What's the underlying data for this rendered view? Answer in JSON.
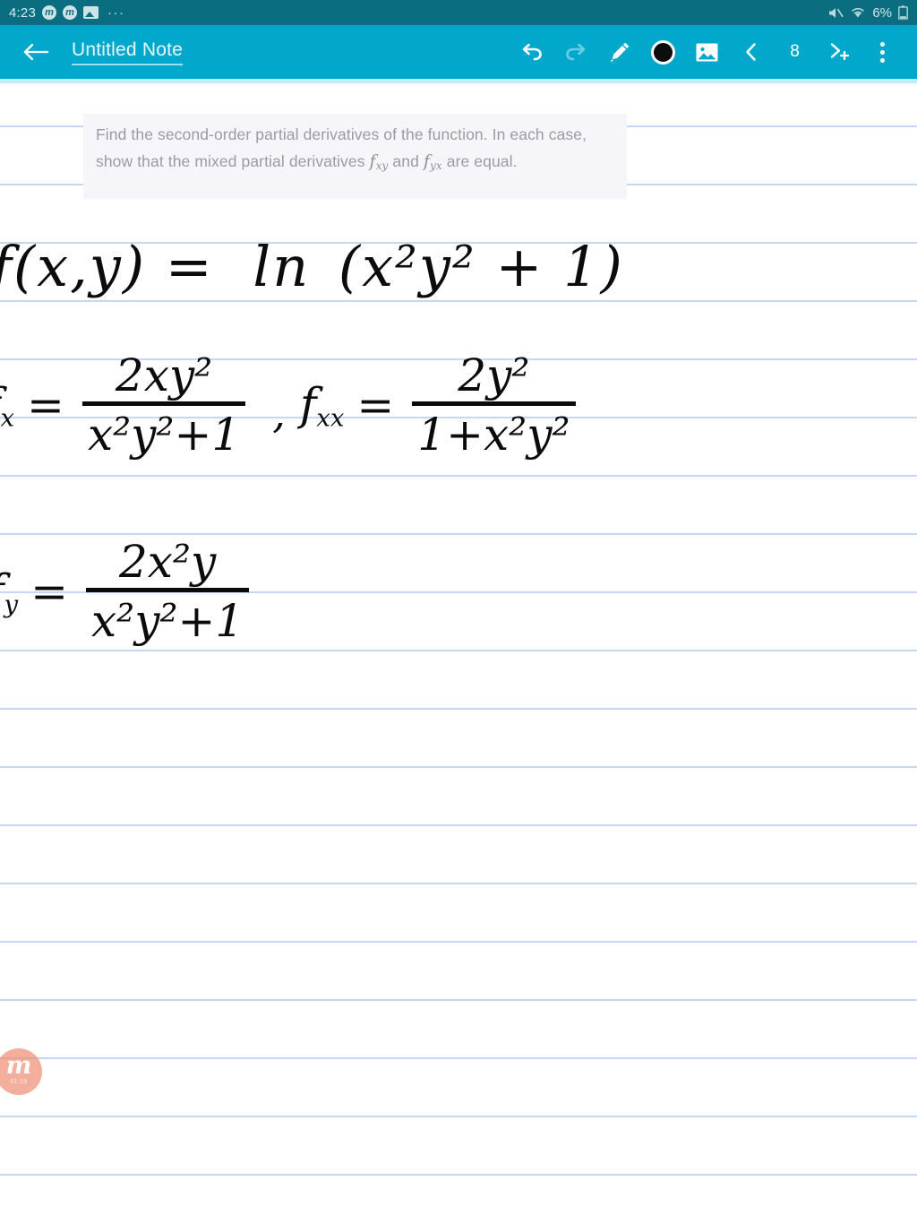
{
  "status_bar": {
    "clock": "4:23",
    "app_badge_1": "m",
    "app_badge_2": "m",
    "image_icon": "image-icon",
    "overflow": "···",
    "mute_icon": "volume-mute-icon",
    "wifi_icon": "wifi-icon",
    "battery_percent": "6%",
    "battery_icon": "battery-icon"
  },
  "app_bar": {
    "back_icon": "back-arrow-icon",
    "note_title": "Untitled Note",
    "tools": [
      {
        "name": "undo-button",
        "icon": "undo-icon",
        "enabled": true
      },
      {
        "name": "redo-button",
        "icon": "redo-icon",
        "enabled": false
      },
      {
        "name": "pen-button",
        "icon": "pencil-icon",
        "enabled": true
      },
      {
        "name": "color-button",
        "icon": "color-swatch",
        "enabled": true
      },
      {
        "name": "insert-image-button",
        "icon": "image-icon",
        "enabled": true
      },
      {
        "name": "prev-page-button",
        "icon": "chevron-left-icon",
        "enabled": true
      }
    ],
    "page_number": "8",
    "add_page_icon": "chevron-right-plus-icon",
    "menu_icon": "kebab-menu-icon",
    "accent_color": "#02a8cb",
    "status_color": "#0a6d80"
  },
  "note": {
    "question_block": {
      "line1": "Find the second-order partial derivatives of the function. In each",
      "line2_a": "case, show that the mixed partial derivatives",
      "math_fxy": "f",
      "math_fxy_sub": "xy",
      "line2_b": "and",
      "math_fyx": "f",
      "math_fyx_sub": "yx",
      "line2_c": "are",
      "line3": "equal.",
      "background": "#f6f6fa",
      "text_color": "#9a9ca1"
    },
    "handwriting": {
      "line1": {
        "lhs": "f(x,y) =",
        "fn": "ln",
        "arg": "(x²y² + 1)",
        "plain": "f(x,y) = ln(x²y² + 1)"
      },
      "line2": {
        "label_a": "f",
        "label_a_sub": "x",
        "eq": "=",
        "num_a": "2xy²",
        "den_a": "x²y²+1",
        "separator": ",",
        "label_b": "f",
        "label_b_sub": "xx",
        "num_b": "2y²",
        "den_b": "1+x²y²",
        "plain": "f_x = 2xy²/(x²y²+1) , f_xx = 2y²/(1+x²y²)"
      },
      "line3": {
        "label": "f",
        "label_sub": "y",
        "eq": "=",
        "num": "2x²y",
        "den": "x²y²+1",
        "plain": "f_y = 2x²y/(x²y²+1)"
      },
      "ink_color": "#0b0b0b"
    },
    "rule_color": "#c4d8f5",
    "rule_spacing_px": 65,
    "paper_color": "#ffffff"
  },
  "watermark": {
    "logo_letter": "m",
    "timestamp": "01:15",
    "color": "#f08a6e"
  }
}
